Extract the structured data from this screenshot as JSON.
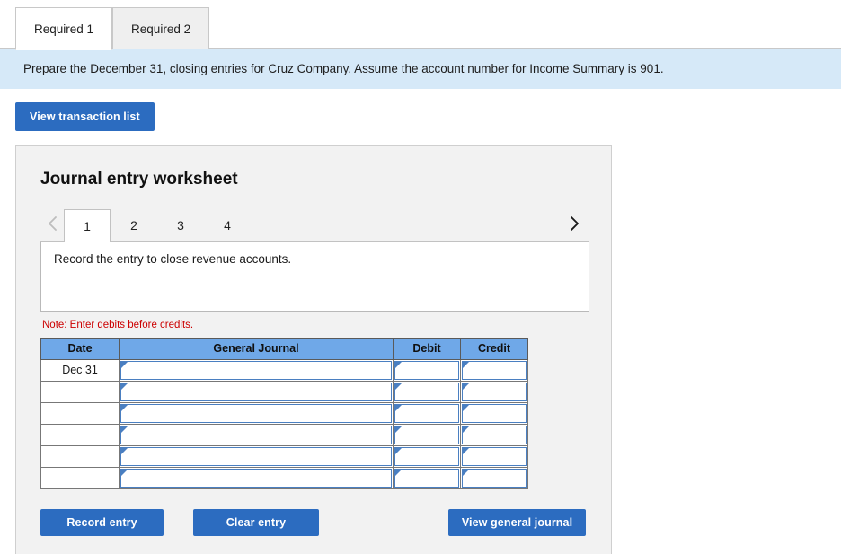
{
  "tabs": [
    {
      "label": "Required 1",
      "active": true
    },
    {
      "label": "Required 2",
      "active": false
    }
  ],
  "banner": {
    "text": "Prepare the December 31, closing entries for Cruz Company. Assume the account number for Income Summary is 901."
  },
  "toolbar": {
    "view_transaction_list": "View transaction list"
  },
  "worksheet": {
    "title": "Journal entry worksheet",
    "pager": {
      "prev_icon": "chevron-left-icon",
      "next_icon": "chevron-right-icon",
      "pages": [
        "1",
        "2",
        "3",
        "4"
      ],
      "active_page": "1"
    },
    "description": "Record the entry to close revenue accounts.",
    "note": "Note: Enter debits before credits.",
    "table": {
      "headers": [
        "Date",
        "General Journal",
        "Debit",
        "Credit"
      ],
      "rows": [
        {
          "date": "Dec 31",
          "general_journal": "",
          "debit": "",
          "credit": ""
        },
        {
          "date": "",
          "general_journal": "",
          "debit": "",
          "credit": ""
        },
        {
          "date": "",
          "general_journal": "",
          "debit": "",
          "credit": ""
        },
        {
          "date": "",
          "general_journal": "",
          "debit": "",
          "credit": ""
        },
        {
          "date": "",
          "general_journal": "",
          "debit": "",
          "credit": ""
        },
        {
          "date": "",
          "general_journal": "",
          "debit": "",
          "credit": ""
        }
      ]
    },
    "actions": {
      "record_entry": "Record entry",
      "clear_entry": "Clear entry",
      "view_general_journal": "View general journal"
    }
  },
  "colors": {
    "button_blue": "#2c6cc0",
    "table_header_blue": "#6fa8e8",
    "banner_blue": "#d6e9f8",
    "panel_gray": "#f2f2f2",
    "note_red": "#cc0000",
    "input_border_blue": "#4a7fc1"
  }
}
